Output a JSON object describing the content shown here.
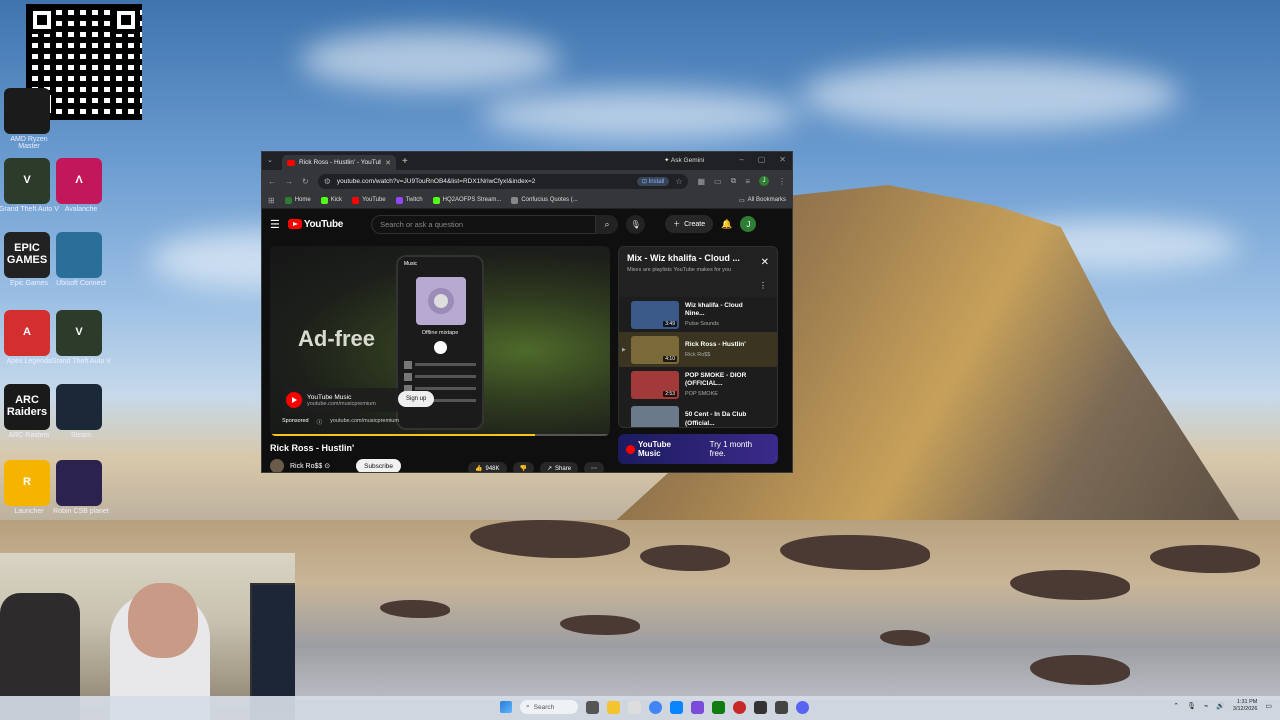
{
  "desktop": {
    "icons": [
      {
        "label": "AMD Ryzen Master",
        "text": "",
        "color": "#1b1b1b"
      },
      {
        "label": "Grand Theft Auto V",
        "text": "V",
        "color": "#2c3b2a"
      },
      {
        "label": "Avalanche",
        "text": "Λ",
        "color": "#c2185b"
      },
      {
        "label": "Epic Games",
        "text": "EPIC\nGAMES",
        "color": "#222222"
      },
      {
        "label": "Ubisoft Connect",
        "text": "",
        "color": "#2a6f9a"
      },
      {
        "label": "Apex Legends",
        "text": "A",
        "color": "#d32f2f"
      },
      {
        "label": "Grand Theft Auto V",
        "text": "V",
        "color": "#2c3b2a"
      },
      {
        "label": "ARC Raiders",
        "text": "ARC\nRaiders",
        "color": "#1a1a1a"
      },
      {
        "label": "Steam",
        "text": "",
        "color": "#1b2838"
      },
      {
        "label": "Launcher",
        "text": "R",
        "color": "#f5b400"
      },
      {
        "label": "Robin CSB planet",
        "text": "",
        "color": "#2b2250"
      }
    ]
  },
  "browser": {
    "tab_title": "Rick Ross - Hustlin' - YouTube",
    "ask_gemini": "Ask Gemini",
    "url": "youtube.com/watch?v=JU9TouRnOB4&list=RDX1NriwCfyxI&index=2",
    "install_label": "Install",
    "account_initial": "J",
    "bookmarks": [
      {
        "label": "Home",
        "color": "#2e7d32"
      },
      {
        "label": "Kick",
        "color": "#53fc18"
      },
      {
        "label": "YouTube",
        "color": "#ff0000"
      },
      {
        "label": "Twitch",
        "color": "#9146ff"
      },
      {
        "label": "HQ2AOFPS Stream...",
        "color": "#53fc18"
      },
      {
        "label": "Confucius Quotes (...",
        "color": "#888888"
      }
    ],
    "all_bookmarks": "All Bookmarks"
  },
  "youtube": {
    "logo_text": "YouTube",
    "search_placeholder": "Search or ask a question",
    "create_label": "Create",
    "account_initial": "J",
    "ad": {
      "headline": "Ad-free",
      "phone_app_label": "Music",
      "phone_album": "Offline mixtape",
      "advertiser": "YouTube Music",
      "advertiser_url": "youtube.com/musicpremium",
      "cta": "Sign up",
      "sponsored": "Sponsored",
      "sponsored_url": "youtube.com/musicpremium",
      "progress": 0.78
    },
    "video_title": "Rick Ross - Hustlin'",
    "channel": "Rick Ro$$",
    "subscribe_label": "Subscribe",
    "like_count": "948K",
    "share_label": "Share",
    "mix": {
      "title": "Mix - Wiz khalifa - Cloud ...",
      "subtitle": "Mixes are playlists YouTube makes for you",
      "items": [
        {
          "title": "Wiz khalifa - Cloud Nine...",
          "channel": "Pulse Sounds",
          "duration": "3:49",
          "thumb": "#3b5a8a"
        },
        {
          "title": "Rick Ross - Hustlin'",
          "channel": "Rick Ro$$",
          "duration": "4:10",
          "thumb": "#7a6a3a"
        },
        {
          "title": "POP SMOKE - DIOR (OFFICIAL...",
          "channel": "POP SMOKE",
          "duration": "2:53",
          "thumb": "#a33a3a"
        },
        {
          "title": "50 Cent - In Da Club (Official...",
          "channel": "",
          "duration": "",
          "thumb": "#6a7a8a"
        }
      ]
    },
    "music_banner": {
      "logo": "YouTube Music",
      "cta": "Try 1 month free."
    }
  },
  "taskbar": {
    "search_placeholder": "Search",
    "time": "1:31 PM",
    "date": "3/12/2026"
  }
}
